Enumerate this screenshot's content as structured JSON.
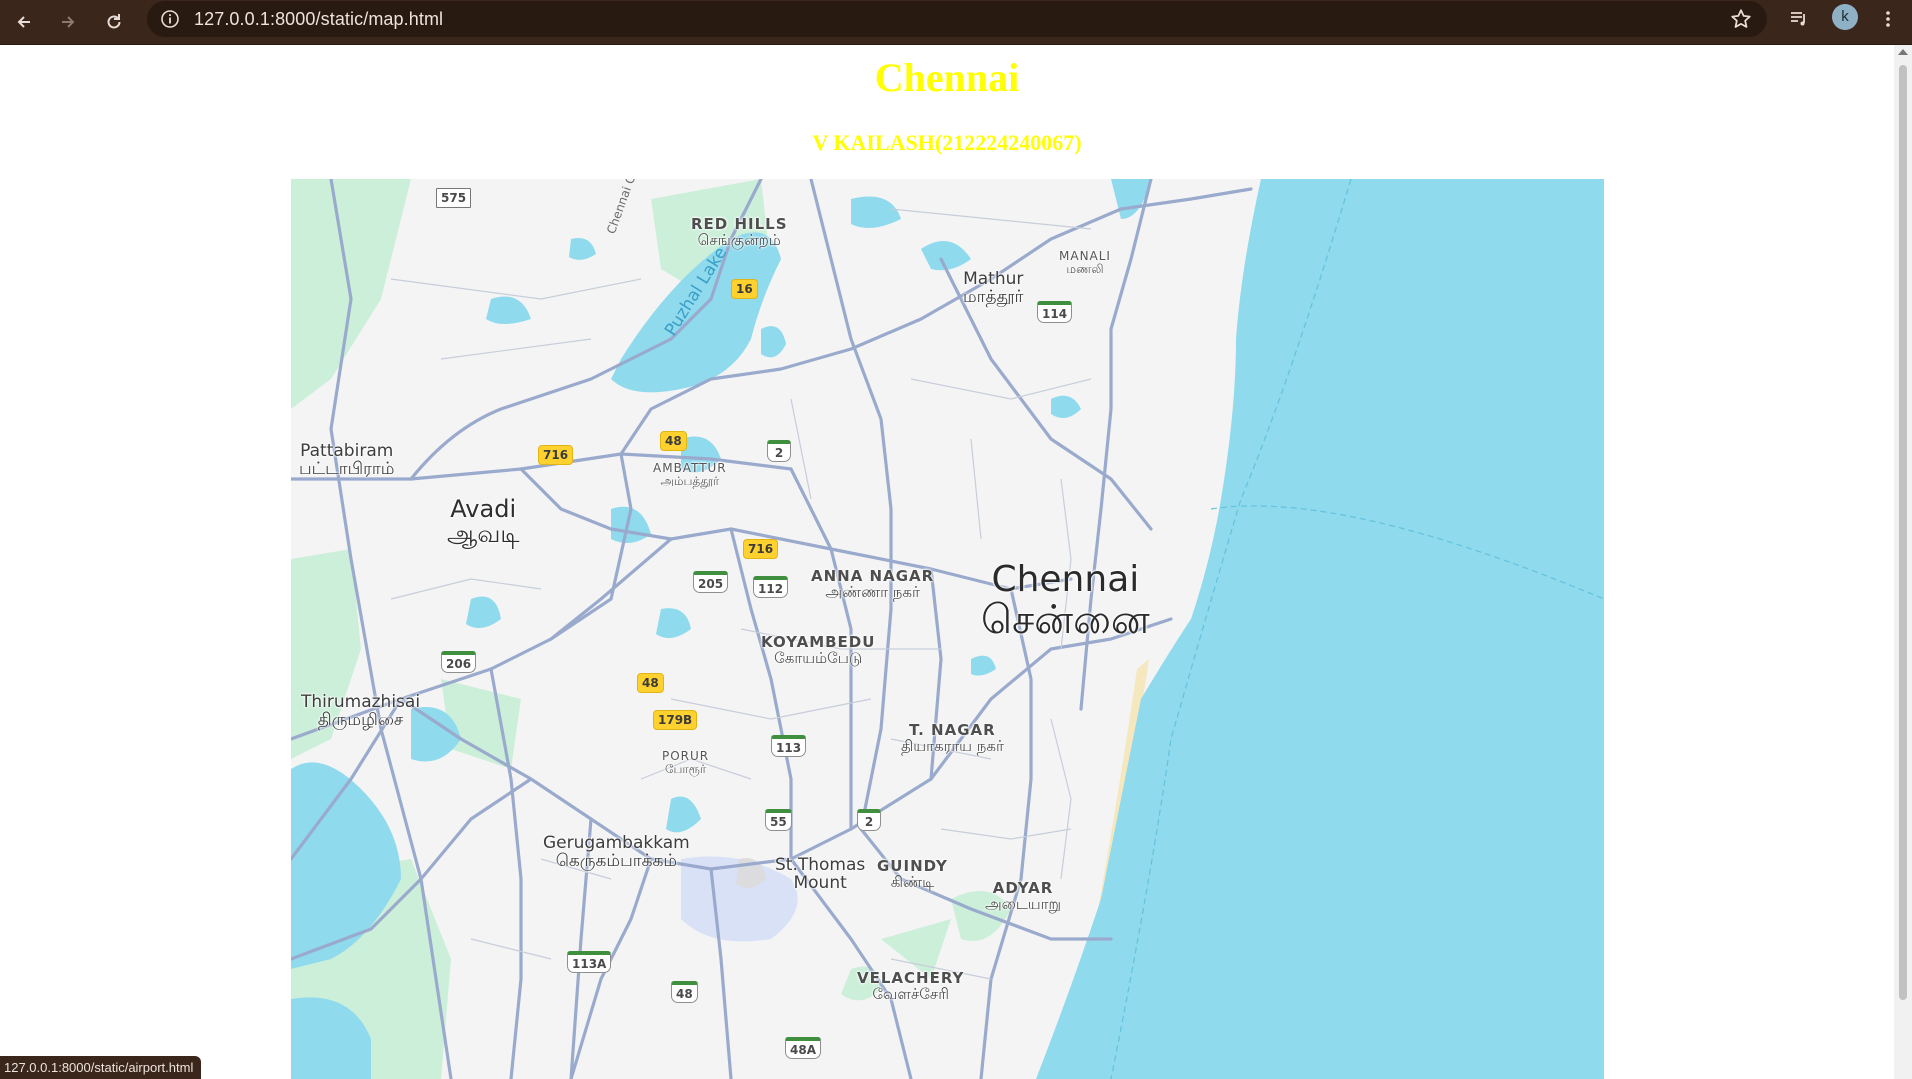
{
  "browser": {
    "url": "127.0.0.1:8000/static/map.html",
    "profile_initial": "k",
    "status_url": "127.0.0.1:8000/static/airport.html"
  },
  "page": {
    "title": "Chennai",
    "subtitle": "V KAILASH(212224240067)",
    "title_color": "#ffff00"
  },
  "map": {
    "colors": {
      "land": "#f4f4f5",
      "water": "#8fdaed",
      "park": "#ccefd9",
      "road": "#9aaacd",
      "beach": "#f5e7be"
    },
    "labels": {
      "red_hills": {
        "en": "RED HILLS",
        "ta": "செங்குன்றம்"
      },
      "manali": {
        "en": "MANALI",
        "ta": "மணலி"
      },
      "mathur": {
        "en": "Mathur",
        "ta": "மாத்தூர்"
      },
      "puzhal_lake": "Puzhal Lake",
      "chennai_road": "Chennai O...",
      "pattabiram": {
        "en": "Pattabiram",
        "ta": "பட்டாபிராம்"
      },
      "ambattur": {
        "en": "AMBATTUR",
        "ta": "அம்பத்தூர்"
      },
      "avadi": {
        "en": "Avadi",
        "ta": "ஆவடி"
      },
      "anna_nagar": {
        "en": "ANNA NAGAR",
        "ta": "அண்ணா நகர்"
      },
      "chennai": {
        "en": "Chennai",
        "ta": "சென்னை"
      },
      "koyambedu": {
        "en": "KOYAMBEDU",
        "ta": "கோயம்பேடு"
      },
      "thirumazhisai": {
        "en": "Thirumazhisai",
        "ta": "திருமழிசை"
      },
      "t_nagar": {
        "en": "T. NAGAR",
        "ta": "தியாகராய நகர்"
      },
      "porur": {
        "en": "PORUR",
        "ta": "போரூர்"
      },
      "gerugambakkam": {
        "en": "Gerugambakkam",
        "ta": "கெருகம்பாக்கம்"
      },
      "st_thomas": {
        "en": "St.Thomas",
        "en2": "Mount"
      },
      "guindy": {
        "en": "GUINDY",
        "ta": "கிண்டி"
      },
      "adyar": {
        "en": "ADYAR",
        "ta": "அடையாறு"
      },
      "velachery": {
        "en": "VELACHERY",
        "ta": "வேளச்சேரி"
      }
    },
    "shields": {
      "s575": "575",
      "s16": "16",
      "s114": "114",
      "s716a": "716",
      "s48a": "48",
      "s2a": "2",
      "s716b": "716",
      "s205": "205",
      "s112": "112",
      "s206": "206",
      "s48b": "48",
      "s179b": "179B",
      "s113": "113",
      "s55": "55",
      "s2b": "2",
      "s113a": "113A",
      "s48c": "48",
      "s48a_alt": "48A"
    }
  }
}
